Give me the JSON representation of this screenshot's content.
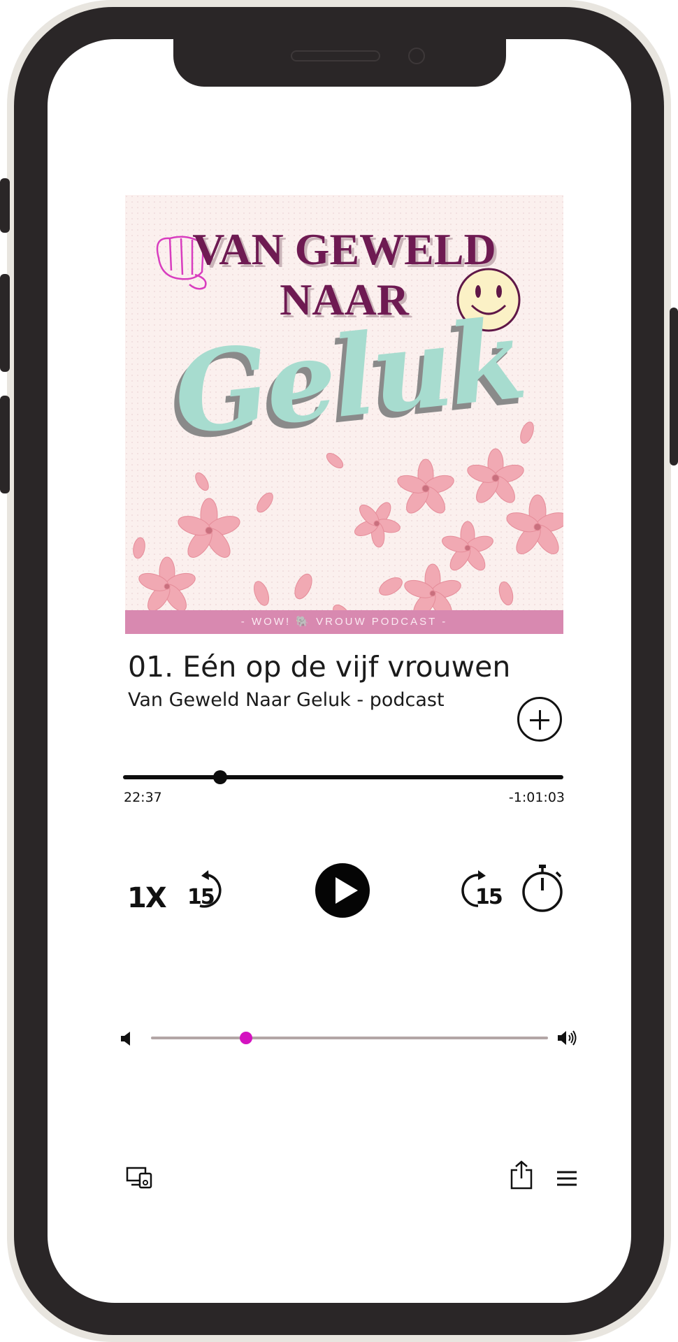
{
  "podcast_cover": {
    "title_line1": "VAN GEWELD",
    "title_line2": "NAAR",
    "script_word": "Geluk",
    "banner_text": "- WOW!  🐘  VROUW PODCAST -"
  },
  "episode": {
    "title": "01. Eén op de vijf vrouwen",
    "podcast": "Van Geweld Naar Geluk - podcast"
  },
  "playback": {
    "elapsed": "22:37",
    "remaining": "-1:01:03",
    "progress_fraction": 0.22,
    "speed_label": "1X",
    "skip_back_seconds": "15",
    "skip_forward_seconds": "15"
  },
  "volume": {
    "level_fraction": 0.24
  },
  "icons": {
    "add": "plus-circle-icon",
    "play": "play-icon",
    "skip_back": "rewind-15-icon",
    "skip_forward": "forward-15-icon",
    "sleep_timer": "stopwatch-icon",
    "volume_low": "speaker-low-icon",
    "volume_high": "speaker-high-icon",
    "airplay": "devices-icon",
    "share": "share-icon",
    "queue": "menu-icon"
  },
  "colors": {
    "accent": "#d412c0",
    "cover_banner": "#d889b0",
    "cover_title": "#6e1a52"
  }
}
